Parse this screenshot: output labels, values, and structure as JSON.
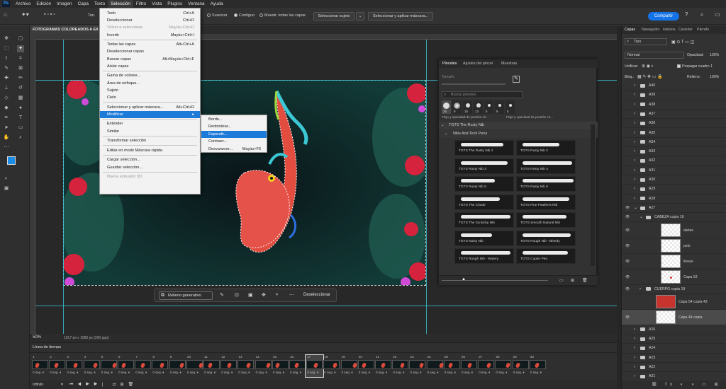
{
  "menubar": {
    "logo": "Ps",
    "items": [
      "Archivo",
      "Edición",
      "Imagen",
      "Capa",
      "Texto",
      "Selección",
      "Filtro",
      "Vista",
      "Plugins",
      "Ventana",
      "Ayuda"
    ],
    "active_index": 5
  },
  "options": {
    "size_label": "Tan.",
    "suavizar": "Suavizar",
    "contiguo": "Contiguo",
    "muestrear": "Muestr. todas las capas",
    "select_subject": "Seleccionar sujeto",
    "select_mask": "Seleccionar y aplicar máscara...",
    "share": "Compartir"
  },
  "document": {
    "tab_title": "FOTOGRAMAS COLOREADOS A EX",
    "zoom": "50%",
    "dimensions": "1917 px x 1083 px (200 ppp)"
  },
  "selection_menu": {
    "items": [
      {
        "label": "Todo",
        "shortcut": "Ctrl+A"
      },
      {
        "label": "Deseleccionar",
        "shortcut": "Ctrl+D"
      },
      {
        "label": "Volver a seleccionar",
        "shortcut": "Mayús+Ctrl+D",
        "disabled": true
      },
      {
        "label": "Invertir",
        "shortcut": "Mayús+Ctrl+I"
      },
      {
        "label": "Todas las capas",
        "shortcut": "Alt+Ctrl+A"
      },
      {
        "label": "Deseleccionar capas",
        "shortcut": ""
      },
      {
        "label": "Buscar capas",
        "shortcut": "Alt+Mayús+Ctrl+F"
      },
      {
        "label": "Aislar capas",
        "shortcut": ""
      },
      {
        "label": "Gama de colores...",
        "shortcut": ""
      },
      {
        "label": "Área de enfoque...",
        "shortcut": ""
      },
      {
        "label": "Sujeto",
        "shortcut": ""
      },
      {
        "label": "Cielo",
        "shortcut": ""
      },
      {
        "label": "Seleccionar y aplicar máscara...",
        "shortcut": "Alt+Ctrl+R"
      },
      {
        "label": "Modificar",
        "shortcut": "▸"
      },
      {
        "label": "Extender",
        "shortcut": ""
      },
      {
        "label": "Similar",
        "shortcut": ""
      },
      {
        "label": "Transformar selección",
        "shortcut": ""
      },
      {
        "label": "Editar en modo Máscara rápida",
        "shortcut": ""
      },
      {
        "label": "Cargar selección...",
        "shortcut": ""
      },
      {
        "label": "Guardar selección...",
        "shortcut": ""
      },
      {
        "label": "Nueva extrusión 3D",
        "shortcut": "",
        "disabled": true
      }
    ]
  },
  "modify_menu": {
    "items": [
      {
        "label": "Borde...",
        "shortcut": ""
      },
      {
        "label": "Redondear...",
        "shortcut": ""
      },
      {
        "label": "Expandir...",
        "shortcut": ""
      },
      {
        "label": "Contraer...",
        "shortcut": ""
      },
      {
        "label": "Desvanecer...",
        "shortcut": "Mayús+F6"
      }
    ],
    "highlighted_index": 2
  },
  "context_bar": {
    "generative_fill": "Relleno generativo",
    "deselect": "Deseleccionar"
  },
  "brushes_panel": {
    "tabs": [
      "Pinceles",
      "Ajustes del pincel",
      "Muestras"
    ],
    "size_label": "Tamaño",
    "search_placeholder": "Buscar pinceles",
    "preset_sizes": [
      "26",
      "9",
      "15",
      "13",
      "5",
      "9",
      "5"
    ],
    "preset_caption_left": "Flujo y opacidad de presión cir...",
    "preset_caption_right": "Flujo y opacidad de presión cir...",
    "group": "TGTS The Rusty Nib",
    "subgroup": "Nibs And Tech Pens",
    "brushes": [
      "TGTS The Rusty Nib 1",
      "TGTS Rusty Nib 2",
      "TGTS Rusty Nib 3",
      "TGTS Rusty Nib 4",
      "TGTS Rusty Nib 5",
      "TGTS Rusty Nib 6",
      "TGTS The Chode",
      "TGTS Fine Feathers Nib",
      "TGTS The Scratchy Nib",
      "TGTS Smooth Natural Nib",
      "TGTS Noisy Nib",
      "TGTS Rough Nib - Bleedy",
      "TGTS Rough Nib - Watery",
      "TGTS Copier Pen"
    ]
  },
  "layers_panel": {
    "tabs": [
      "Capas",
      "Navegador",
      "Historia",
      "Carácter",
      "Párrafo"
    ],
    "filter": "Tipo",
    "blend": "Normal",
    "opacity_label": "Opacidad:",
    "opacity": "100%",
    "unify_label": "Unificar:",
    "propagate": "Propagar cuadro 1",
    "lock_label": "Bloq.:",
    "fill_label": "Relleno:",
    "fill": "100%",
    "layers": [
      {
        "name": "A40",
        "type": "group"
      },
      {
        "name": "A39",
        "type": "group"
      },
      {
        "name": "A38",
        "type": "group"
      },
      {
        "name": "A37",
        "type": "group"
      },
      {
        "name": "A36",
        "type": "group"
      },
      {
        "name": "A35",
        "type": "group"
      },
      {
        "name": "A34",
        "type": "group"
      },
      {
        "name": "A33",
        "type": "group"
      },
      {
        "name": "A32",
        "type": "group"
      },
      {
        "name": "A31",
        "type": "group"
      },
      {
        "name": "A30",
        "type": "group"
      },
      {
        "name": "A29",
        "type": "group"
      },
      {
        "name": "A28",
        "type": "group"
      },
      {
        "name": "A27",
        "type": "group",
        "visible": true
      },
      {
        "name": "CABEZA copia 16",
        "type": "group",
        "visible": true
      },
      {
        "name": "aletas",
        "type": "layer",
        "visible": true
      },
      {
        "name": "pelo",
        "type": "layer",
        "visible": true
      },
      {
        "name": "lineas",
        "type": "layer",
        "visible": true
      },
      {
        "name": "Capa 53",
        "type": "layer",
        "visible": true
      },
      {
        "name": "CUERPO copia 19",
        "type": "group",
        "visible": true
      },
      {
        "name": "Capa 54 copia 43",
        "type": "layer"
      },
      {
        "name": "Capa 44 copia",
        "type": "layer",
        "visible": true,
        "selected": true
      },
      {
        "name": "A26",
        "type": "group"
      },
      {
        "name": "A25",
        "type": "group"
      },
      {
        "name": "A24",
        "type": "group"
      },
      {
        "name": "A23",
        "type": "group"
      },
      {
        "name": "A22",
        "type": "group"
      },
      {
        "name": "A21",
        "type": "group"
      }
    ]
  },
  "timeline": {
    "title": "Línea de tiempo",
    "loop": "Infinito",
    "frame_duration": "0 seg.",
    "selected_frame": 17,
    "frame_count": 30
  }
}
